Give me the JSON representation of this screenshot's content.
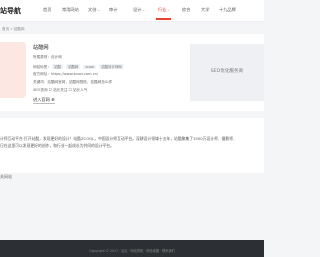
{
  "header": {
    "logo": "站导航",
    "nav": [
      {
        "label": "首页",
        "dropdown": false,
        "active": false
      },
      {
        "label": "常用网站",
        "dropdown": false,
        "active": false
      },
      {
        "label": "文创",
        "dropdown": true,
        "active": false
      },
      {
        "label": "审计",
        "dropdown": false,
        "active": false
      },
      {
        "label": "设计",
        "dropdown": true,
        "active": false
      },
      {
        "label": "行业",
        "dropdown": true,
        "active": true
      },
      {
        "label": "综合",
        "dropdown": false,
        "active": false
      },
      {
        "label": "大学",
        "dropdown": false,
        "active": false
      },
      {
        "label": "十九品牌",
        "dropdown": false,
        "active": false
      }
    ],
    "chevron": "⌄",
    "accent": "#e8412f"
  },
  "breadcrumb": {
    "text": "首页 » 站酷网"
  },
  "site": {
    "title": "站酷网",
    "category": "所属类别：设计网",
    "tags_label": "网站标签：",
    "tags": [
      "站酷",
      "站酷网",
      "zcool",
      "站酷设计师网"
    ],
    "url": "官方网址：https://www.zcool.com.cn/",
    "related_label": "关键词：站酷网官网，站酷网登陆，站酷网怎么样",
    "meta": "SEO查询    ☐ 站长关注    ☐ 站长人气",
    "visit_label": "进入官网 ⊕"
  },
  "seo_box": {
    "label": "SEO优化服务商"
  },
  "description": {
    "text": "计师互动平台·打开站酷，发现更好的设计！站酷ZCOOL，中国设计师互动平台。深耕设计领域十五年，站酷聚集了1500万设计师、摄影师、"
  },
  "description2": {
    "text": "日在这里可以发现更好的创作，和行业一起成长为共同的设计平台。"
  },
  "related": {
    "label": "关网站"
  },
  "footer": {
    "text": "Copyright © 2017 · 站点 · 网站导航 · 网站地图 · 联系我们"
  }
}
